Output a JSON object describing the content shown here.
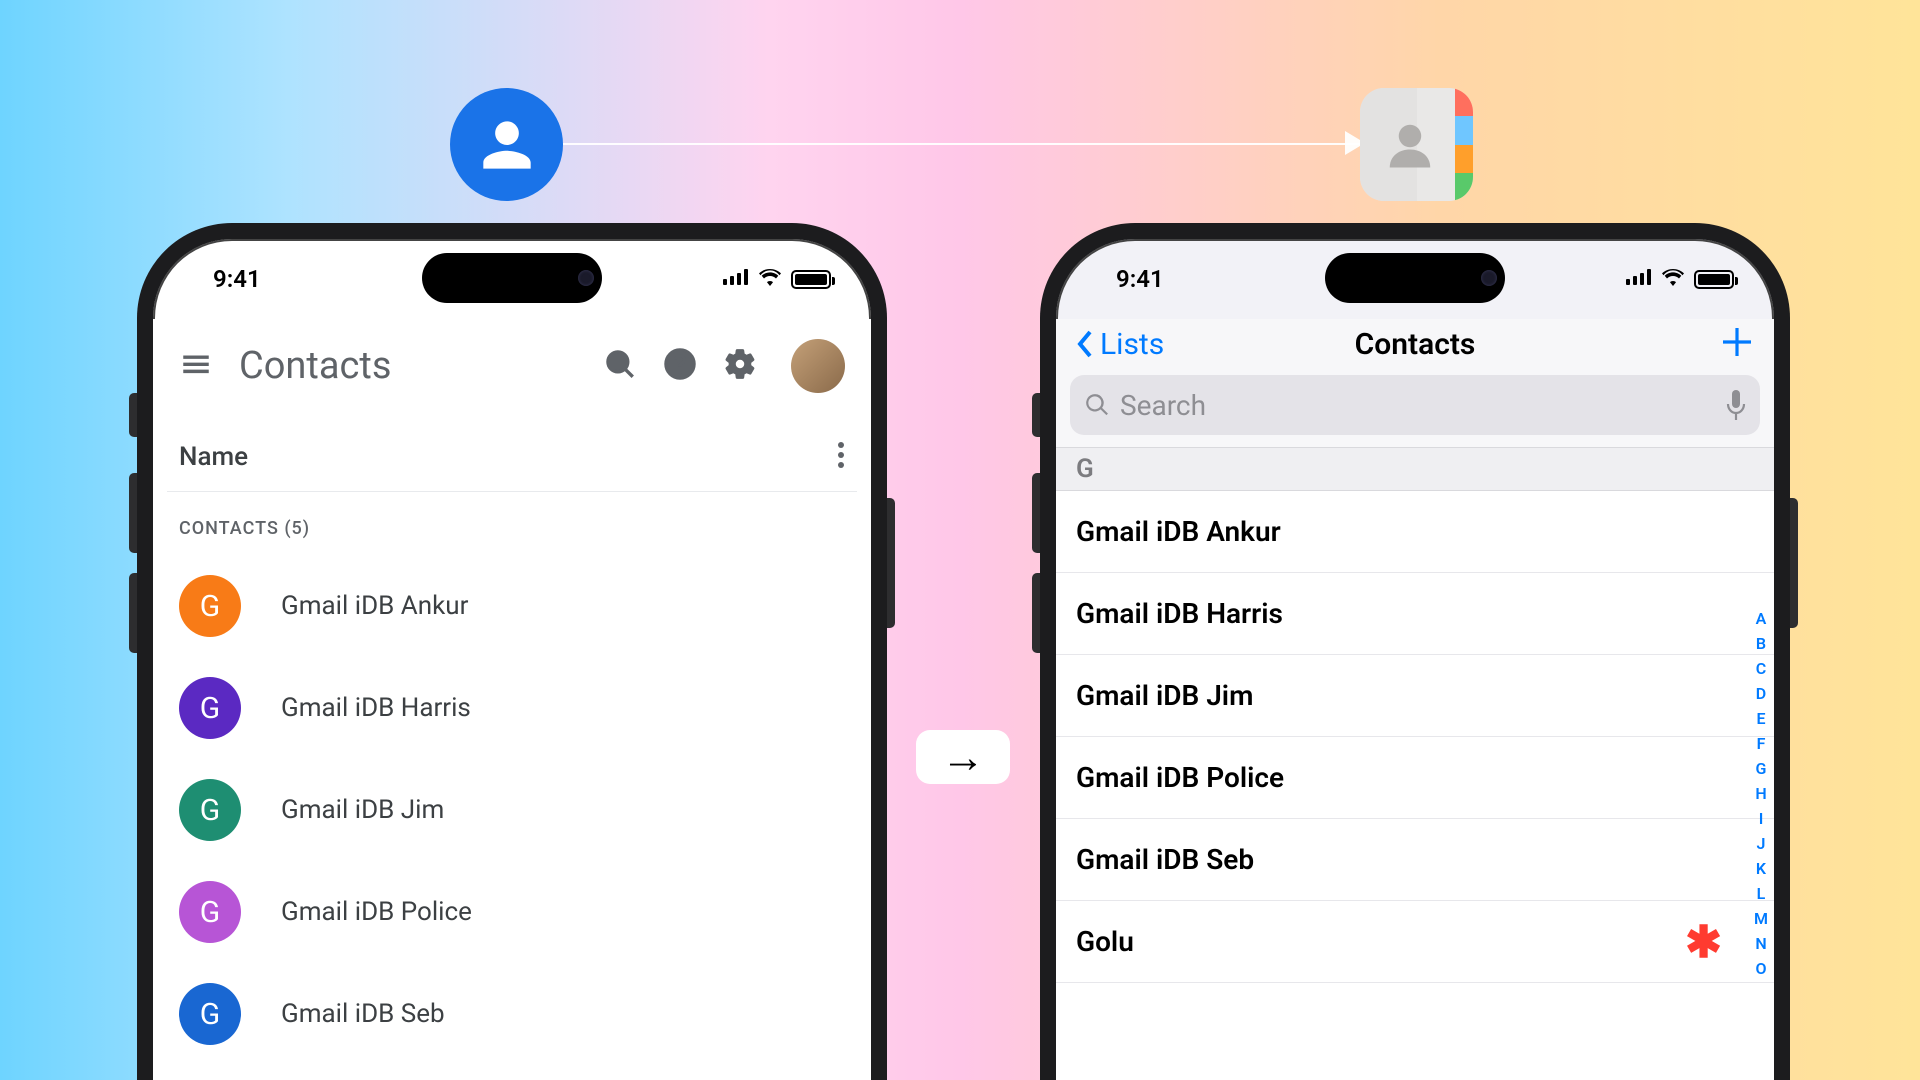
{
  "status_time": "9:41",
  "colors": {
    "ios_blue": "#007aff",
    "google_blue": "#1a73e8"
  },
  "google_contacts": {
    "app_title": "Contacts",
    "sort_label": "Name",
    "section_label": "CONTACTS (5)",
    "badge_letter": "G",
    "badge_colors": [
      "#f87b17",
      "#5b29c2",
      "#1e8e72",
      "#b755d6",
      "#1967d2"
    ],
    "contacts": [
      "Gmail iDB Ankur",
      "Gmail iDB Harris",
      "Gmail iDB Jim",
      "Gmail iDB Police",
      "Gmail iDB Seb"
    ]
  },
  "apple_contacts": {
    "back_label": "Lists",
    "title": "Contacts",
    "search_placeholder": "Search",
    "section_letter": "G",
    "rows": [
      {
        "name": "Gmail iDB Ankur",
        "starred": false
      },
      {
        "name": "Gmail iDB Harris",
        "starred": false
      },
      {
        "name": "Gmail iDB Jim",
        "starred": false
      },
      {
        "name": "Gmail iDB Police",
        "starred": false
      },
      {
        "name": "Gmail iDB Seb",
        "starred": false
      },
      {
        "name": "Golu",
        "starred": true
      }
    ],
    "index_letters": [
      "A",
      "B",
      "C",
      "D",
      "E",
      "F",
      "G",
      "H",
      "I",
      "J",
      "K",
      "L",
      "M",
      "N",
      "O"
    ]
  },
  "mid_arrow": "→"
}
